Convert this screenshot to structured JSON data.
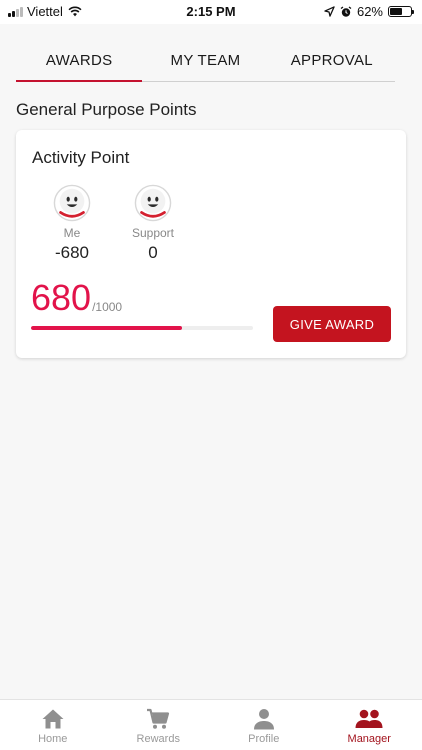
{
  "status_bar": {
    "carrier": "Viettel",
    "time": "2:15 PM",
    "battery_percent": "62%",
    "battery_level": 0.62
  },
  "tabs": [
    {
      "label": "AWARDS",
      "active": true
    },
    {
      "label": "MY TEAM",
      "active": false
    },
    {
      "label": "APPROVAL",
      "active": false
    }
  ],
  "section_title": "General Purpose Points",
  "card": {
    "title": "Activity Point",
    "members": [
      {
        "label": "Me",
        "value": "-680"
      },
      {
        "label": "Support",
        "value": "0"
      }
    ],
    "points_current": "680",
    "points_total": "/1000",
    "progress_fraction": 0.68,
    "give_award_label": "GIVE AWARD"
  },
  "bottom_nav": [
    {
      "label": "Home",
      "icon": "home-icon",
      "active": false
    },
    {
      "label": "Rewards",
      "icon": "cart-icon",
      "active": false
    },
    {
      "label": "Profile",
      "icon": "person-icon",
      "active": false
    },
    {
      "label": "Manager",
      "icon": "group-icon",
      "active": true
    }
  ],
  "colors": {
    "accent": "#c4122f",
    "points": "#e2134a",
    "button": "#c4141f",
    "nav_active": "#a3141e",
    "nav_inactive": "#999999"
  }
}
